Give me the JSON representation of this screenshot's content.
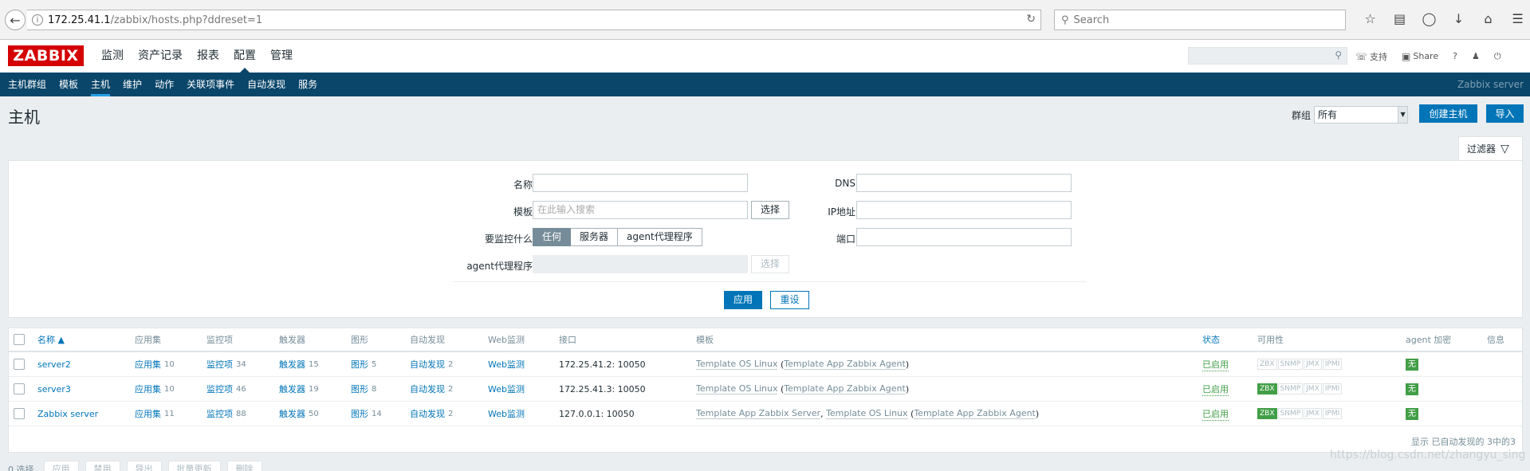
{
  "browser": {
    "url_host": "172.25.41.1",
    "url_path": "/zabbix/hosts.php?ddreset=1",
    "search_placeholder": "Search"
  },
  "header": {
    "logo": "ZABBIX",
    "main_menu": [
      "监测",
      "资产记录",
      "报表",
      "配置",
      "管理"
    ],
    "main_menu_active": "配置",
    "support": "支持",
    "share": "Share",
    "help": "?",
    "sub_menu": [
      "主机群组",
      "模板",
      "主机",
      "维护",
      "动作",
      "关联项事件",
      "自动发现",
      "服务"
    ],
    "sub_menu_active": "主机",
    "server_name": "Zabbix server"
  },
  "page": {
    "title": "主机",
    "group_label": "群组",
    "group_value": "所有",
    "create_button": "创建主机",
    "import_button": "导入"
  },
  "filter": {
    "tab_label": "过滤器",
    "name_label": "名称",
    "template_label": "模板",
    "template_placeholder": "在此输入搜索",
    "select_button": "选择",
    "monitored_label": "要监控什么",
    "monitored_options": [
      "任何",
      "服务器",
      "agent代理程序"
    ],
    "monitored_selected": "任何",
    "proxy_label": "agent代理程序",
    "proxy_select_button": "选择",
    "dns_label": "DNS",
    "ip_label": "IP地址",
    "port_label": "端口",
    "apply_button": "应用",
    "reset_button": "重设"
  },
  "table": {
    "columns": {
      "name": "名称 ▲",
      "apps": "应用集",
      "items": "监控项",
      "triggers": "触发器",
      "graphs": "图形",
      "discovery": "自动发现",
      "web": "Web监测",
      "interface": "接口",
      "templates": "模板",
      "status": "状态",
      "availability": "可用性",
      "encryption": "agent 加密",
      "info": "信息"
    },
    "rows": [
      {
        "name": "server2",
        "apps_label": "应用集",
        "apps_count": "10",
        "items_label": "监控项",
        "items_count": "34",
        "triggers_label": "触发器",
        "triggers_count": "15",
        "graphs_label": "图形",
        "graphs_count": "5",
        "discovery_label": "自动发现",
        "discovery_count": "2",
        "web": "Web监测",
        "interface": "172.25.41.2: 10050",
        "tpl_a": "Template OS Linux",
        "tpl_b": "",
        "tpl_paren": "Template App Zabbix Agent",
        "status": "已启用",
        "zbx_on": false,
        "encryption": "无"
      },
      {
        "name": "server3",
        "apps_label": "应用集",
        "apps_count": "10",
        "items_label": "监控项",
        "items_count": "46",
        "triggers_label": "触发器",
        "triggers_count": "19",
        "graphs_label": "图形",
        "graphs_count": "8",
        "discovery_label": "自动发现",
        "discovery_count": "2",
        "web": "Web监测",
        "interface": "172.25.41.3: 10050",
        "tpl_a": "Template OS Linux",
        "tpl_b": "",
        "tpl_paren": "Template App Zabbix Agent",
        "status": "已启用",
        "zbx_on": true,
        "encryption": "无"
      },
      {
        "name": "Zabbix server",
        "apps_label": "应用集",
        "apps_count": "11",
        "items_label": "监控项",
        "items_count": "88",
        "triggers_label": "触发器",
        "triggers_count": "50",
        "graphs_label": "图形",
        "graphs_count": "14",
        "discovery_label": "自动发现",
        "discovery_count": "2",
        "web": "Web监测",
        "interface": "127.0.0.1: 10050",
        "tpl_a": "Template App Zabbix Server",
        "tpl_b": "Template OS Linux",
        "tpl_paren": "Template App Zabbix Agent",
        "status": "已启用",
        "zbx_on": true,
        "encryption": "无"
      }
    ],
    "availability_badges": [
      "ZBX",
      "SNMP",
      "JMX",
      "IPMI"
    ],
    "footer": "显示 已自动发现的 3中的3"
  },
  "bottom": {
    "selected": "0 选择",
    "actions": [
      "应用",
      "禁用",
      "导出",
      "批量更新",
      "删除"
    ]
  },
  "watermark": "https://blog.csdn.net/zhangyu_sing",
  "colors": {
    "brand_red": "#d40000",
    "nav_blue": "#0a466a",
    "link_blue": "#0275b8",
    "enabled_green": "#429e47"
  }
}
